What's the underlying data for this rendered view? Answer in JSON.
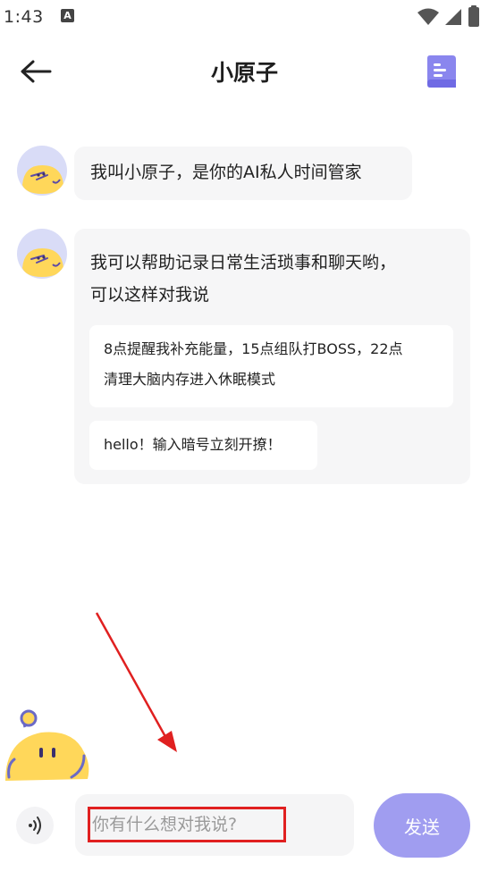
{
  "status_bar": {
    "time": "1:43",
    "notification_icon": "A"
  },
  "header": {
    "title": "小原子"
  },
  "messages": [
    {
      "text": "我叫小原子，是你的AI私人时间管家"
    },
    {
      "text_line1": "我可以帮助记录日常生活琐事和聊天哟，",
      "text_line2": "可以这样对我说",
      "suggestions": [
        {
          "line1": "8点提醒我补充能量，15点组队打BOSS，22点",
          "line2": "清理大脑内存进入休眠模式"
        },
        {
          "line1": "hello！输入暗号立刻开撩！"
        }
      ]
    }
  ],
  "input": {
    "placeholder": "你有什么想对我说?",
    "value": ""
  },
  "send_label": "发送",
  "colors": {
    "accent": "#a09df0",
    "highlight": "#e02020",
    "avatar_bg": "#d9dcf7",
    "mascot": "#ffd75a"
  },
  "icons": [
    "back-arrow-icon",
    "document-icon",
    "voice-icon",
    "wifi-icon",
    "signal-icon",
    "battery-icon"
  ]
}
